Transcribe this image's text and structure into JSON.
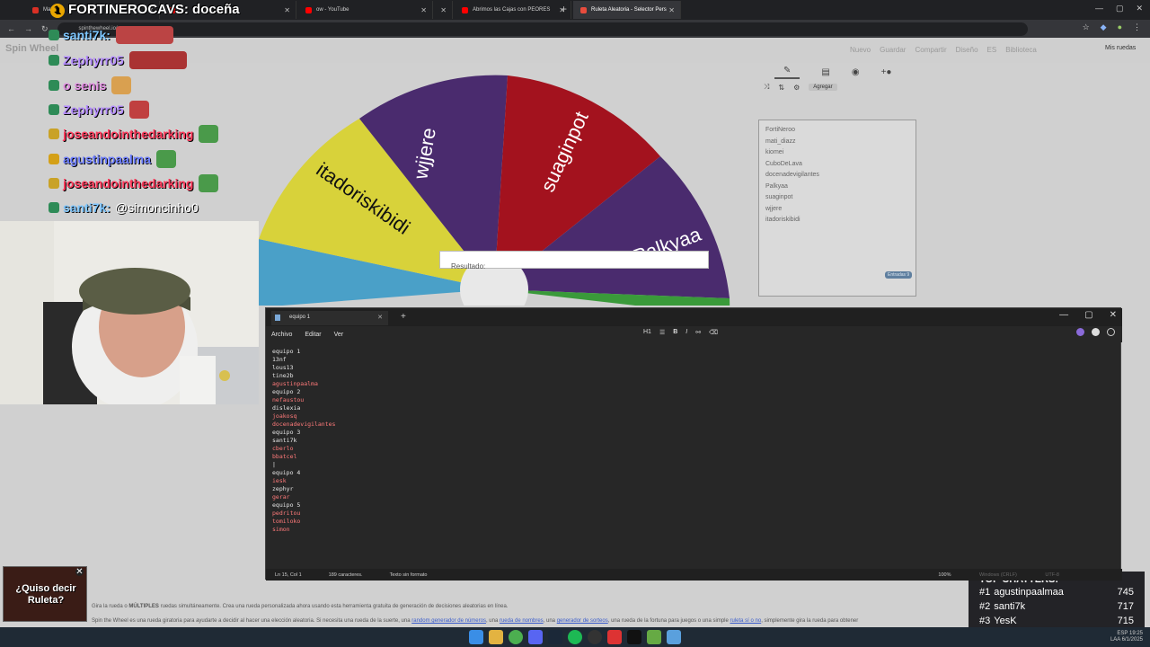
{
  "browser": {
    "tabs": [
      {
        "label": "Mateca",
        "color": "#d93025",
        "active": false
      },
      {
        "label": "",
        "color": "#ff0000",
        "active": false
      },
      {
        "label": "ow - YouTube",
        "color": "#ff0000",
        "active": false
      },
      {
        "label": "",
        "color": "#888888",
        "active": false
      },
      {
        "label": "Abrimos las Cajas con PEORES",
        "color": "#ff0000",
        "active": false
      },
      {
        "label": "Ruleta Aleatoria - Selector Pers",
        "color": "#e84c3d",
        "active": true
      }
    ],
    "url": "spinthewheel.io/es"
  },
  "stream": {
    "title_num": "1",
    "title": "FORTINEROCAVS: doceña",
    "chat": [
      {
        "user": "santi7k:",
        "color": "#7dc6ff",
        "badge_color": "#2e8b57",
        "emote": "wide",
        "emote_color": "#b44"
      },
      {
        "user": "Zephyrr05",
        "color": "#b58cff",
        "badge_color": "#2e8b57",
        "emote": "wide",
        "emote_color": "#a33"
      },
      {
        "user": "o senis",
        "color": "#e08ae0",
        "badge_color": "#2e8b57",
        "emote": "small",
        "emote_color": "#d9a050"
      },
      {
        "user": "Zephyrr05",
        "color": "#b58cff",
        "badge_color": "#2e8b57",
        "emote": "small",
        "emote_color": "#c04040"
      },
      {
        "user": "joseandointhedarking",
        "color": "#ff3b5c",
        "badge_color": "#c9a227",
        "emote": "small",
        "emote_color": "#4a9a4a"
      },
      {
        "user": "agustinpaalma",
        "color": "#6b7cff",
        "badge_color": "#d4a017",
        "emote": "small",
        "emote_color": "#4a9a4a"
      },
      {
        "user": "joseandointhedarking",
        "color": "#ff3b5c",
        "badge_color": "#c9a227",
        "emote": "small",
        "emote_color": "#4a9a4a"
      },
      {
        "user": "santi7k:",
        "color": "#7dc6ff",
        "badge_color": "#2e8b57",
        "emote": "none",
        "message": "@simoncinho0"
      }
    ]
  },
  "site": {
    "logo": "Spin Wheel",
    "nav": [
      "Nuevo",
      "Guardar",
      "Compartir",
      "Diseño",
      "ES",
      "Biblioteca"
    ],
    "mis_ruedas": "Mis ruedas",
    "agregar": "Agregar",
    "entries": [
      "FortiNeroo",
      "mati_diazz",
      "kiomei",
      "CuboDeLava",
      "docenadevigilantes",
      "Palkyaa",
      "suaginpot",
      "wjjere",
      "itadoriskibidi"
    ],
    "entries_badge": "Entradas 9",
    "result_label": "Resultado:",
    "wheel_labels": [
      "wjjere",
      "suaginpot",
      "Palkyaa",
      "itadoriskibidi"
    ],
    "footer_line1_pre": "Gira la rueda o ",
    "footer_line1_bold": "MÚLTIPLES",
    "footer_line1_post": " ruedas simultáneamente. Crea una rueda personalizada ahora usando esta herramienta gratuita de generación de decisiones aleatorias en línea.",
    "footer_line2_a": "Spin the Wheel es una rueda giratoria para ayudarte a decidir al hacer una elección aleatoria. Si necesita una rueda de la suerte, una ",
    "footer_link1": "random generador de números",
    "footer_line2_b": ", una ",
    "footer_link2": "rueda de nombres",
    "footer_line2_c": ", una ",
    "footer_link3": "generador de sorteos",
    "footer_line2_d": ", una rueda de la fortuna para juegos o una simple ",
    "footer_link4": "ruleta sí o no",
    "footer_line2_e": ", simplemente gira la rueda para obtener"
  },
  "colors": {
    "purple": "#4a2b6e",
    "red": "#a3121e",
    "yellow": "#d8d23a",
    "blue": "#4aa0c8",
    "green": "#3a9a3a"
  },
  "roulette_badge": {
    "text_line1": "¿Quiso decir",
    "text_line2": "Ruleta?"
  },
  "top_chatters": {
    "title": "TOP CHATTERS:",
    "rows": [
      {
        "rank": "#1",
        "name": "agustinpaalmaa",
        "count": "745"
      },
      {
        "rank": "#2",
        "name": "santi7k",
        "count": "717"
      },
      {
        "rank": "#3",
        "name": "YesK",
        "count": "715"
      }
    ]
  },
  "notepad": {
    "tab_title": "equipo 1",
    "menu": [
      "Archivo",
      "Editar",
      "Ver"
    ],
    "heading": "H1",
    "lines": [
      {
        "text": "equipo 1",
        "red": false
      },
      {
        "text": "13nf",
        "red": false
      },
      {
        "text": "lous13",
        "red": false
      },
      {
        "text": "tine2b",
        "red": false
      },
      {
        "text": "agustinpaalma",
        "red": true
      },
      {
        "text": "equipo 2",
        "red": false
      },
      {
        "text": "nefaustou",
        "red": true
      },
      {
        "text": "dislexia",
        "red": false
      },
      {
        "text": "joakosq",
        "red": true
      },
      {
        "text": "docenadevigilantes",
        "red": true
      },
      {
        "text": "equipo 3",
        "red": false
      },
      {
        "text": "santi7k",
        "red": false
      },
      {
        "text": "cberlo",
        "red": true
      },
      {
        "text": "bbatcel",
        "red": true
      },
      {
        "text": "|",
        "red": false
      },
      {
        "text": "equipo 4",
        "red": false
      },
      {
        "text": "iesk",
        "red": true
      },
      {
        "text": "zephyr",
        "red": false
      },
      {
        "text": "gerar",
        "red": true
      },
      {
        "text": "equipo 5",
        "red": false
      },
      {
        "text": "pedritou",
        "red": true
      },
      {
        "text": "tomiloko",
        "red": true
      },
      {
        "text": "simon",
        "red": true
      }
    ],
    "status_pos": "Ln 15, Col 1",
    "status_chars": "189 caracteres.",
    "status_format": "Texto sin formato",
    "status_zoom": "100%",
    "status_eol": "Windows (CRLF)",
    "status_enc": "UTF-8"
  },
  "taskbar": {
    "tray_lang": "ESP",
    "tray_region": "LAA",
    "tray_time": "19:25",
    "tray_date": "6/1/2025"
  }
}
